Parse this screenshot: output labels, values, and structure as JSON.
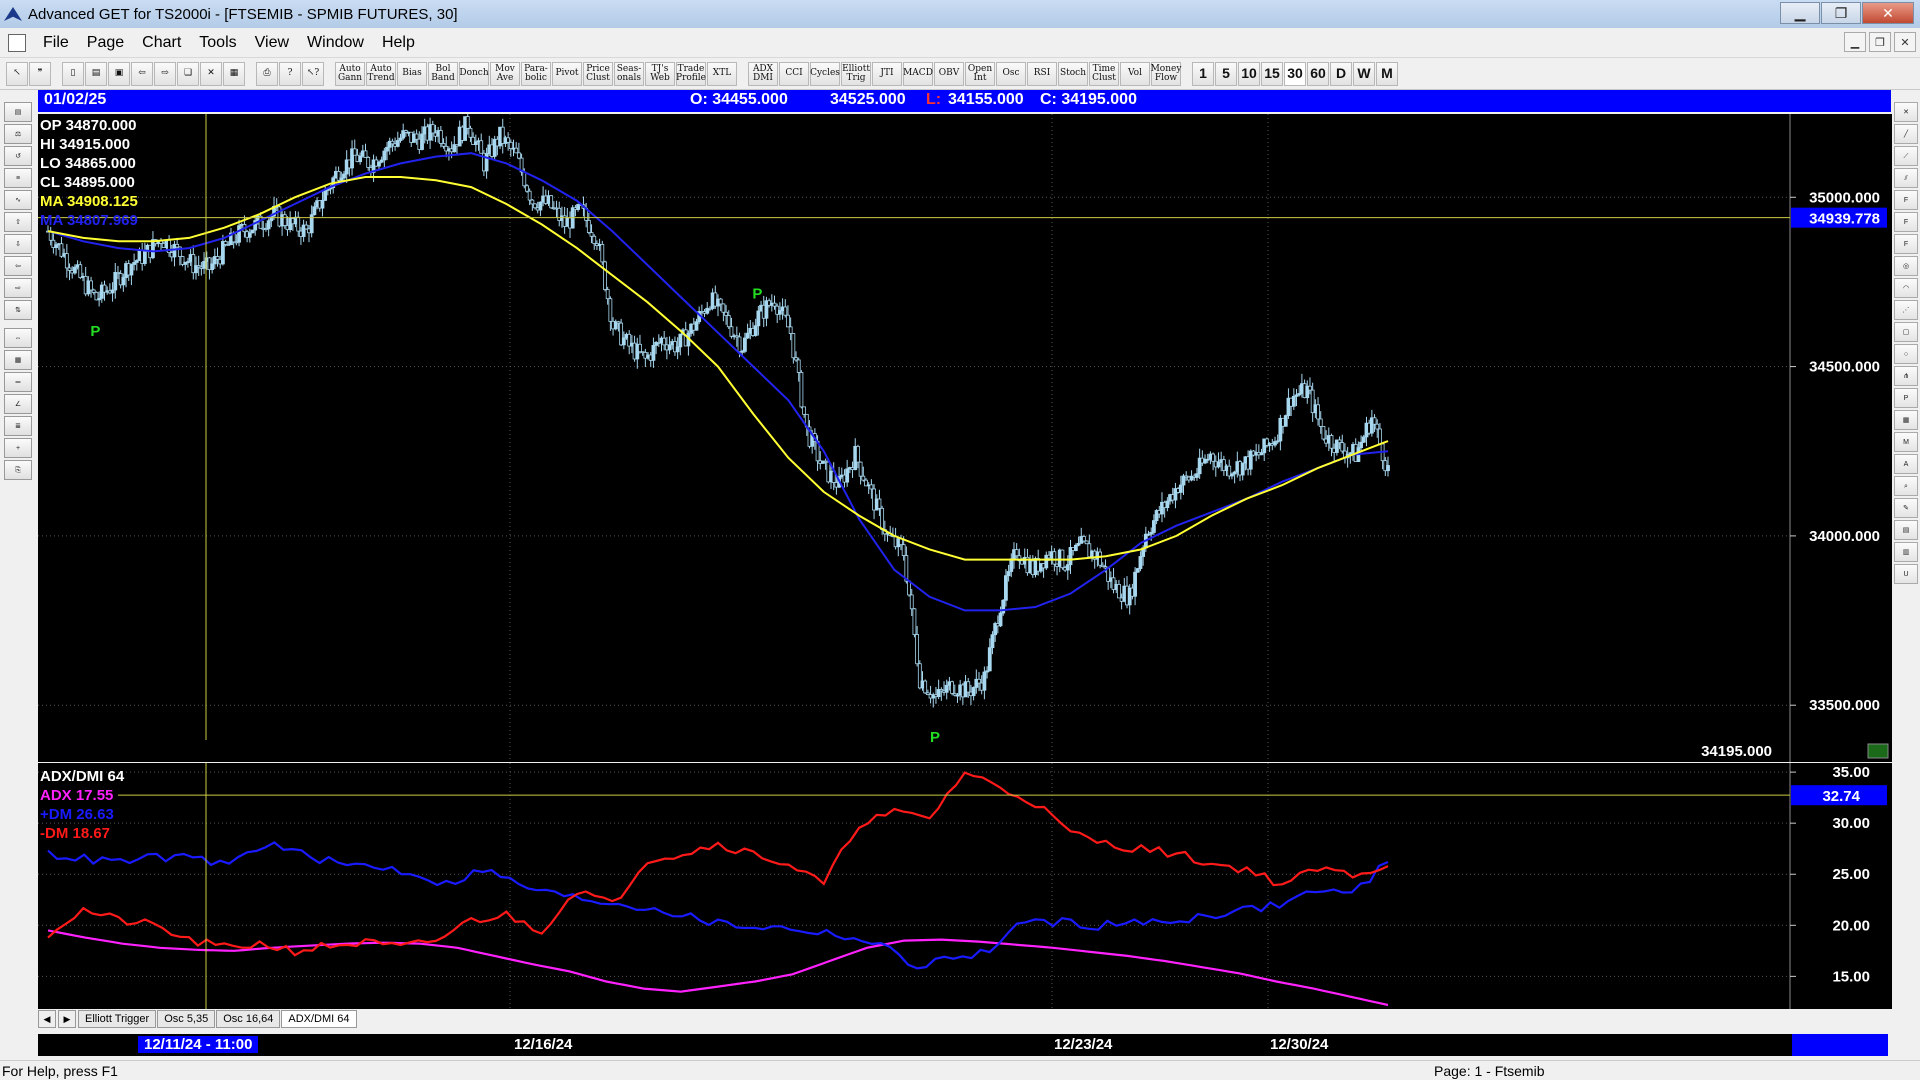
{
  "window": {
    "title": "Advanced GET for TS2000i - [FTSEMIB - SPMIB FUTURES, 30]",
    "minimize": "▁",
    "restore": "❐",
    "close": "✕"
  },
  "menu": [
    "File",
    "Page",
    "Chart",
    "Tools",
    "View",
    "Window",
    "Help"
  ],
  "toolbar": {
    "indicator_buttons": [
      "Auto Gann",
      "Auto Trend",
      "Bias",
      "Bol Band",
      "Donch",
      "Mov Ave",
      "Para-bolic",
      "Pivot",
      "Price Clust",
      "Seas-onals",
      "TJ's Web",
      "Trade Profile",
      "XTL"
    ],
    "study_buttons": [
      "ADX DMI",
      "CCI",
      "Cycles",
      "Elliott Trig",
      "JTI",
      "MACD",
      "OBV",
      "Open Int",
      "Osc",
      "RSI",
      "Stoch",
      "Time Clust",
      "Vol",
      "Money Flow"
    ],
    "timeframes": [
      "1",
      "5",
      "10",
      "15",
      "30",
      "60",
      "D",
      "W",
      "M"
    ]
  },
  "header": {
    "date": "01/02/25",
    "open": "O: 34455.000",
    "high": "34525.000",
    "low_label": "L:",
    "low": "34155.000",
    "close": "C: 34195.000"
  },
  "legend": {
    "op": "OP  34870.000",
    "hi": "HI   34915.000",
    "lo": "LO  34865.000",
    "cl": "CL  34895.000",
    "ma1": "MA  34908.125",
    "ma2": "MA  34807.969"
  },
  "main_axis": {
    "ticks": [
      "35000.000",
      "34500.000",
      "34000.000",
      "33500.000"
    ],
    "cursor_value": "34939.778",
    "last_value": "34195.000"
  },
  "pivot_label": "P",
  "indicator_legend": {
    "title": "ADX/DMI 64",
    "adx": "ADX 17.55",
    "pdm": "+DM 26.63",
    "mdm": "-DM  18.67"
  },
  "indicator_axis": {
    "ticks": [
      "35.00",
      "30.00",
      "25.00",
      "20.00",
      "15.00"
    ],
    "cursor_value": "32.74"
  },
  "tabs": [
    "Elliott Trigger",
    "Osc 5,35",
    "Osc 16,64",
    "ADX/DMI 64"
  ],
  "time_axis": {
    "selected": "12/11/24 - 11:00",
    "labels": [
      "12/16/24",
      "12/23/24",
      "12/30/24"
    ]
  },
  "status": {
    "help": "For Help, press F1",
    "page": "Page: 1 - Ftsemib"
  },
  "colors": {
    "up_candle": "#a8d8f0",
    "down_candle": "#a8d8f0",
    "ma_fast": "#ffff33",
    "ma_slow": "#2222ee",
    "adx": "#ff22ff",
    "pdm": "#1a1aff",
    "mdm": "#ff1a1a",
    "pivot": "#22dd22"
  },
  "chart_data": [
    {
      "type": "candlestick",
      "x_labels": [
        "12/11/24 - 11:00",
        "12/16/24",
        "12/23/24",
        "12/30/24"
      ],
      "ylim": [
        33350,
        35240
      ],
      "close_path": [
        34900,
        34830,
        34760,
        34700,
        34740,
        34800,
        34830,
        34880,
        34840,
        34800,
        34790,
        34850,
        34900,
        34920,
        34950,
        34920,
        34900,
        35000,
        35080,
        35120,
        35100,
        35150,
        35180,
        35170,
        35200,
        35150,
        35220,
        35100,
        35180,
        35120,
        34990,
        34980,
        34920,
        34960,
        34880,
        34620,
        34560,
        34520,
        34580,
        34560,
        34620,
        34700,
        34640,
        34560,
        34650,
        34700,
        34600,
        34310,
        34200,
        34150,
        34240,
        34120,
        34000,
        33950,
        33580,
        33520,
        33560,
        33540,
        33580,
        33800,
        33960,
        33900,
        33950,
        33920,
        33970,
        33940,
        33850,
        33820,
        34010,
        34080,
        34150,
        34180,
        34240,
        34200,
        34210,
        34240,
        34290,
        34410,
        34430,
        34300,
        34260,
        34240,
        34350,
        34195
      ],
      "fast_ma": [
        34900,
        34880,
        34870,
        34870,
        34880,
        34910,
        34950,
        35000,
        35040,
        35060,
        35060,
        35050,
        35030,
        34980,
        34920,
        34850,
        34770,
        34690,
        34600,
        34500,
        34360,
        34230,
        34130,
        34060,
        34000,
        33960,
        33930,
        33930,
        33930,
        33930,
        33940,
        33960,
        34000,
        34060,
        34110,
        34150,
        34200,
        34240,
        34280
      ],
      "slow_ma": [
        34900,
        34870,
        34850,
        34840,
        34850,
        34880,
        34930,
        34980,
        35030,
        35070,
        35100,
        35120,
        35130,
        35100,
        35050,
        34990,
        34900,
        34800,
        34700,
        34600,
        34500,
        34400,
        34250,
        34050,
        33900,
        33820,
        33780,
        33780,
        33790,
        33830,
        33900,
        33980,
        34030,
        34070,
        34110,
        34160,
        34200,
        34240,
        34250
      ],
      "pivots": [
        {
          "date_index": 3,
          "value": 34650,
          "label": "P"
        },
        {
          "date_index": 44,
          "value": 34760,
          "label": "P"
        },
        {
          "date_index": 55,
          "value": 33450,
          "label": "P"
        }
      ]
    },
    {
      "type": "line",
      "title": "ADX/DMI 64",
      "ylim": [
        12,
        35.5
      ],
      "series": [
        {
          "name": "ADX",
          "values": [
            19.5,
            18.8,
            18.2,
            17.8,
            17.6,
            17.5,
            17.8,
            18.0,
            18.2,
            18.3,
            18.2,
            17.8,
            17.0,
            16.2,
            15.5,
            14.5,
            13.8,
            13.5,
            14.0,
            14.5,
            15.2,
            16.5,
            17.8,
            18.5,
            18.6,
            18.4,
            18.1,
            17.8,
            17.4,
            17.0,
            16.5,
            15.9,
            15.3,
            14.5,
            13.8,
            13.0,
            12.2
          ]
        },
        {
          "name": "+DM",
          "values": [
            27.0,
            26.5,
            26.2,
            26.7,
            26.5,
            26.0,
            28.0,
            27.0,
            26.0,
            25.8,
            25.2,
            24.0,
            25.5,
            24.0,
            23.0,
            22.5,
            22.0,
            21.5,
            20.5,
            20.0,
            19.8,
            19.5,
            19.0,
            18.0,
            16.0,
            16.8,
            17.5,
            20.5,
            20.3,
            20.0,
            20.2,
            20.4,
            21.0,
            21.5,
            22.0,
            23.5,
            23.0,
            26.2
          ]
        },
        {
          "name": "-DM",
          "values": [
            19.2,
            21.5,
            20.5,
            20.0,
            18.5,
            17.8,
            18.2,
            17.5,
            18.0,
            18.3,
            17.8,
            18.5,
            20.5,
            21.0,
            19.5,
            23.5,
            22.0,
            26.5,
            27.0,
            28.0,
            27.0,
            26.0,
            24.0,
            30.0,
            31.0,
            30.5,
            35.0,
            33.5,
            32.0,
            29.0,
            28.0,
            27.5,
            27.0,
            26.0,
            25.5,
            24.0,
            25.5,
            25.0,
            25.8
          ]
        }
      ]
    }
  ]
}
